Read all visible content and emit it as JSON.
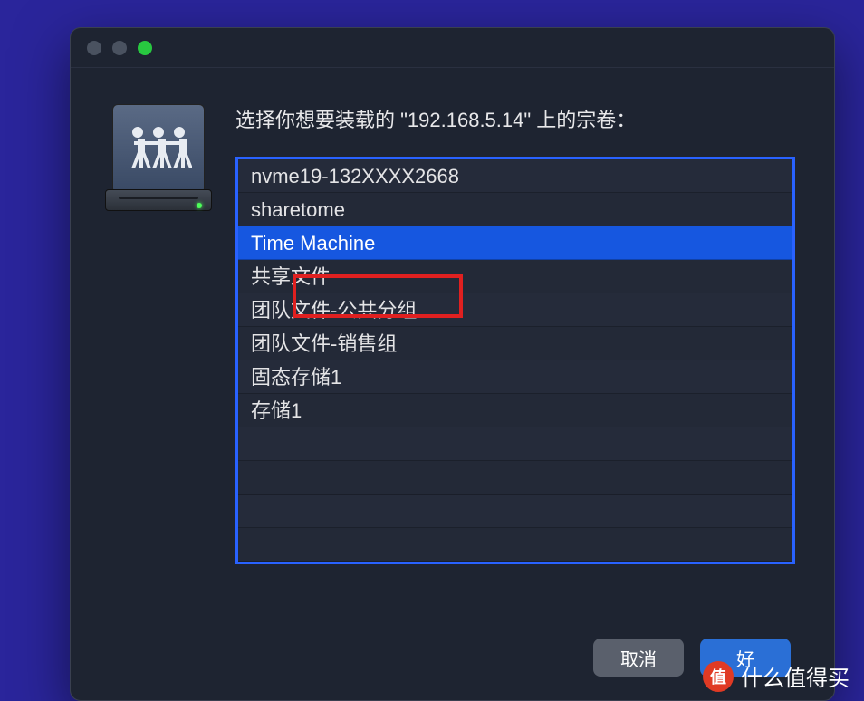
{
  "dialog": {
    "prompt": "选择你想要装载的 \"192.168.5.14\" 上的宗卷：",
    "volumes": [
      {
        "label": "nvme19-132XXXX2668",
        "selected": false
      },
      {
        "label": "sharetome",
        "selected": false
      },
      {
        "label": "Time Machine",
        "selected": true
      },
      {
        "label": "共享文件",
        "selected": false
      },
      {
        "label": "团队文件-公共分组",
        "selected": false
      },
      {
        "label": "团队文件-销售组",
        "selected": false
      },
      {
        "label": "固态存储1",
        "selected": false
      },
      {
        "label": "存储1",
        "selected": false
      }
    ],
    "buttons": {
      "cancel": "取消",
      "ok": "好"
    }
  },
  "watermark": {
    "badge": "值",
    "text": "什么值得买"
  },
  "annotation": {
    "highlighted_item": "Time Machine"
  }
}
